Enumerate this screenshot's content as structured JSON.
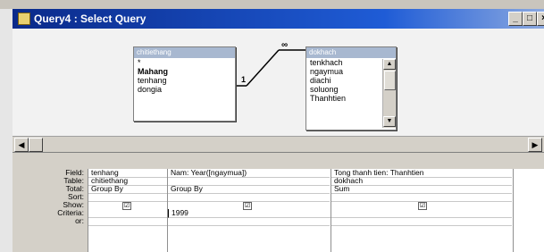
{
  "window": {
    "title": "Query4 : Select Query",
    "controls": {
      "minimize": "_",
      "restore": "□",
      "close": "×"
    }
  },
  "tables": [
    {
      "name": "chitiethang",
      "fields": [
        "*",
        "Mahang",
        "tenhang",
        "dongia"
      ],
      "key_field": "Mahang"
    },
    {
      "name": "dokhach",
      "fields": [
        "tenkhach",
        "ngaymua",
        "diachi",
        "soluong",
        "Thanhtien"
      ]
    }
  ],
  "join": {
    "left_label": "1",
    "right_label": "∞"
  },
  "grid": {
    "row_labels": [
      "Field:",
      "Table:",
      "Total:",
      "Sort:",
      "Show:",
      "Criteria:",
      "or:"
    ],
    "columns": [
      {
        "field": "tenhang",
        "table": "chitiethang",
        "total": "Group By",
        "sort": "",
        "show": true,
        "criteria": "",
        "or": ""
      },
      {
        "field": "Nam: Year([ngaymua])",
        "table": "",
        "total": "Group By",
        "sort": "",
        "show": true,
        "criteria": "1999",
        "or": ""
      },
      {
        "field": "Tong thanh tien: Thanhtien",
        "table": "dokhach",
        "total": "Sum",
        "sort": "",
        "show": true,
        "criteria": "",
        "or": ""
      }
    ]
  },
  "icons": {
    "app": "query-icon",
    "check": "☑"
  }
}
